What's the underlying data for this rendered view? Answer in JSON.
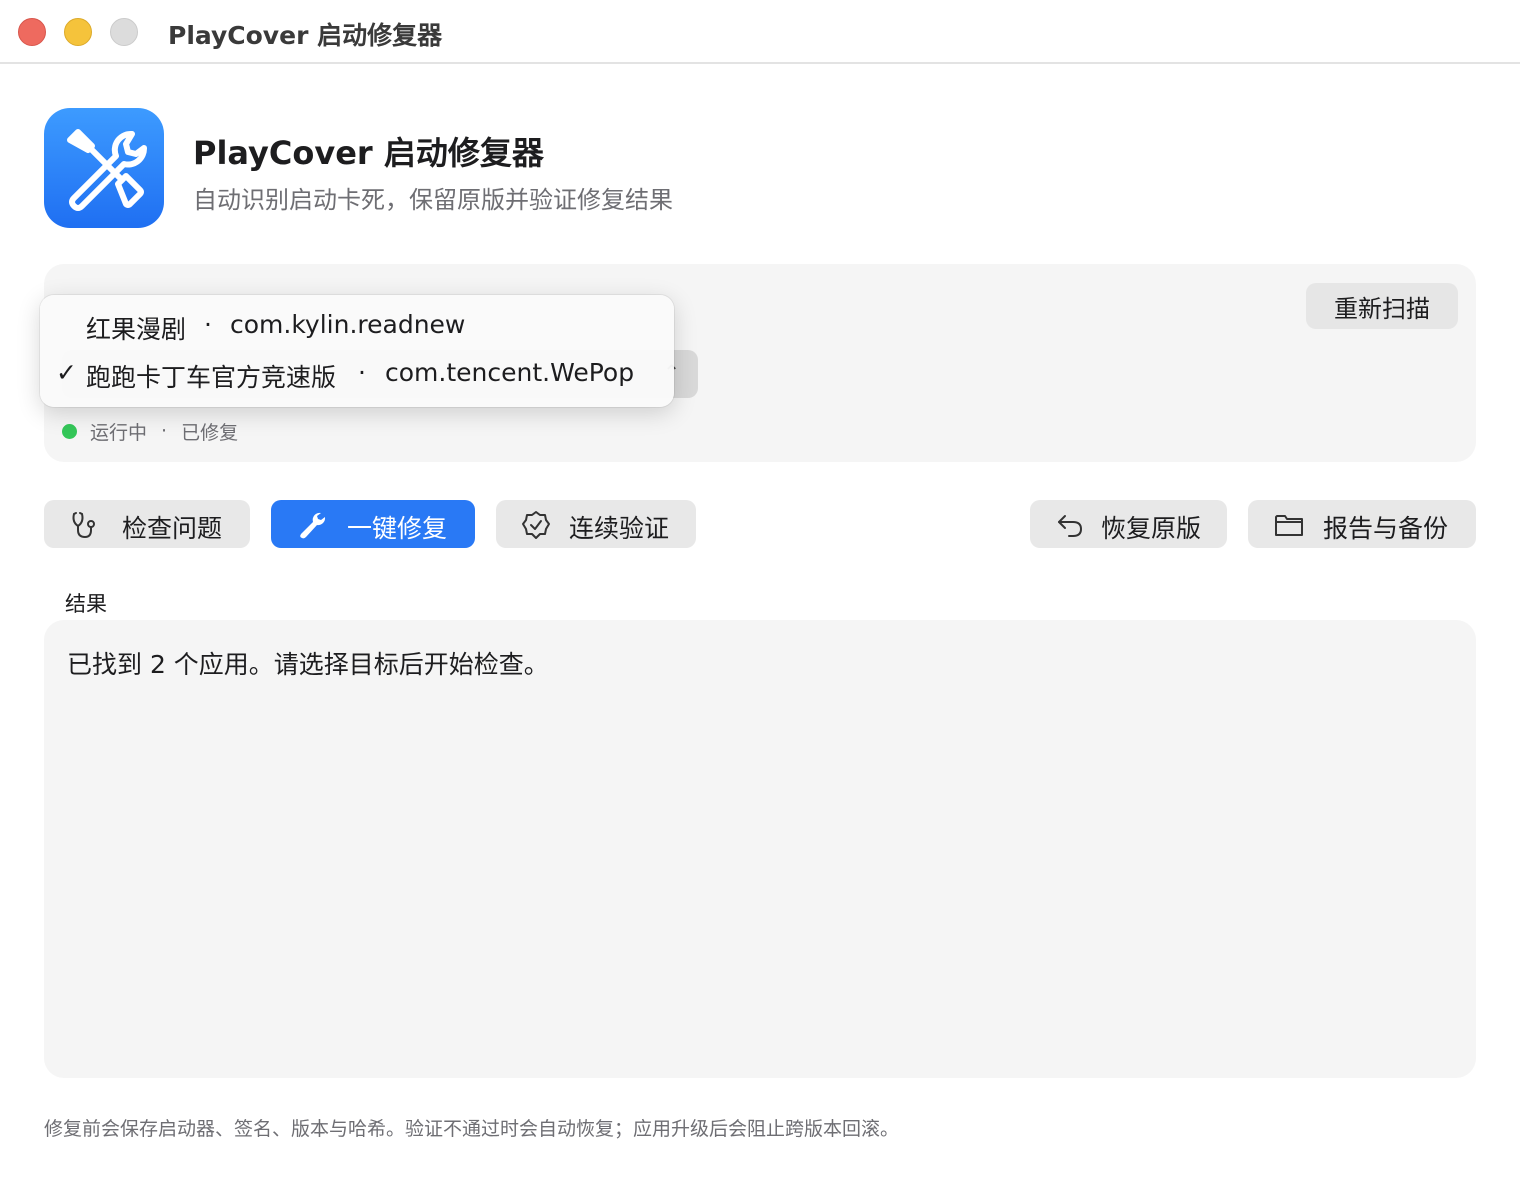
{
  "window": {
    "title": "PlayCover 启动修复器",
    "controls": [
      "close",
      "minimize",
      "zoom"
    ]
  },
  "header": {
    "icon": "wrench-screwdriver-icon",
    "title": "PlayCover 启动修复器",
    "subtitle": "自动识别启动卡死，保留原版并验证修复结果"
  },
  "app_selector": {
    "rescan_label": "重新扫描",
    "menu": {
      "items": [
        {
          "name": "红果漫剧",
          "separator": "·",
          "bundle_id": "com.kylin.readnew",
          "checked": false
        },
        {
          "name": "跑跑卡丁车官方竞速版",
          "separator": "·",
          "bundle_id": "com.tencent.WePop",
          "checked": true
        }
      ],
      "check_glyph": "✓"
    },
    "status": {
      "running": "运行中",
      "separator": "·",
      "state": "已修复",
      "dot_color": "#34c759"
    }
  },
  "actions": {
    "inspect": "检查问题",
    "fix": "一键修复",
    "verify": "连续验证",
    "restore": "恢复原版",
    "report": "报告与备份"
  },
  "result": {
    "label": "结果",
    "text": "已找到 2 个应用。请选择目标后开始检查。"
  },
  "footer": {
    "note": "修复前会保存启动器、签名、版本与哈希。验证不通过时会自动恢复；应用升级后会阻止跨版本回滚。"
  },
  "colors": {
    "accent": "#2979f5",
    "icon_gradient_top": "#3d9bff",
    "icon_gradient_bottom": "#1f6ff2",
    "close": "#ee6a5f",
    "minimize": "#f5c33b",
    "zoom": "#dcdcdc"
  }
}
